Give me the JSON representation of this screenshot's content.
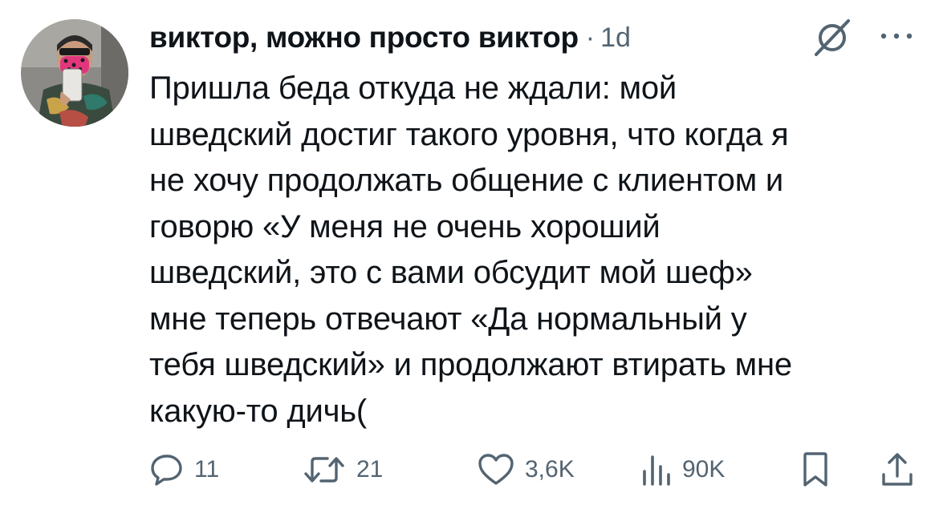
{
  "tweet": {
    "author": "виктор, можно просто виктор",
    "separator": "·",
    "time": "1d",
    "text_lines": [
      "Пришла беда откуда не ждали: мой",
      "шведский достиг такого уровня, что когда я",
      "не хочу продолжать общение с клиентом и",
      "говорю «У меня не очень хороший",
      "шведский, это с вами обсудит мой шеф»",
      "мне теперь отвечают «Да нормальный у",
      "тебя шведский» и продолжают втирать мне",
      "какую-то дичь("
    ]
  },
  "header_icons": {
    "grok": "grok-slash-icon",
    "more": "more-dots-icon"
  },
  "actions": {
    "reply": {
      "icon": "reply-bubble-icon",
      "count": "11"
    },
    "retweet": {
      "icon": "retweet-icon",
      "count": "21"
    },
    "like": {
      "icon": "heart-icon",
      "count": "3,6K"
    },
    "views": {
      "icon": "views-bars-icon",
      "count": "90K"
    },
    "bookmark": {
      "icon": "bookmark-icon"
    },
    "share": {
      "icon": "share-icon"
    }
  },
  "colors": {
    "text": "#0f1419",
    "secondary": "#536471",
    "mask": "#e2367c",
    "avatar_bg": "#8c8a86"
  }
}
